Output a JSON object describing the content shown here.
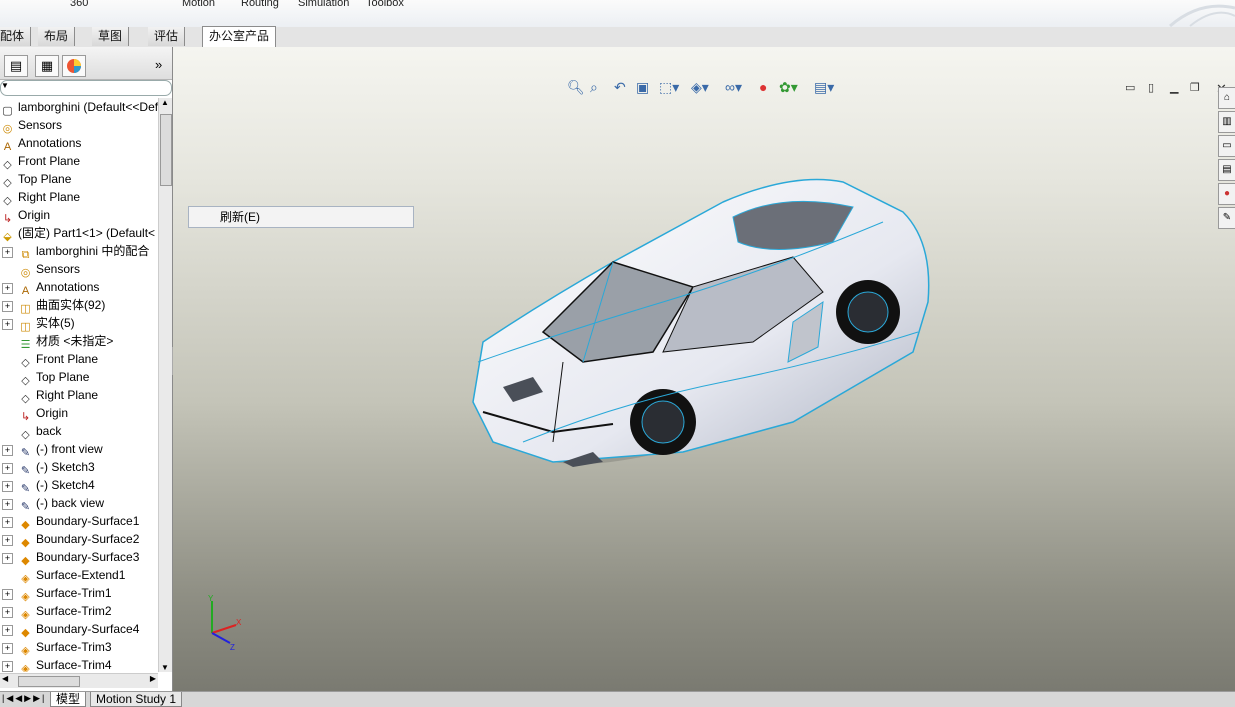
{
  "topbar": {
    "items": [
      "360",
      "Motion",
      "Routing",
      "Simulation",
      "Toolbox"
    ]
  },
  "tabs": [
    {
      "label": "配体",
      "active": false
    },
    {
      "label": "布局",
      "active": false
    },
    {
      "label": "草图",
      "active": false
    },
    {
      "label": "评估",
      "active": false
    },
    {
      "label": "办公室产品",
      "active": true
    }
  ],
  "panel": {
    "collapse_label": "»"
  },
  "tree": [
    {
      "label": "lamborghini  (Default<<Defau",
      "icon": "part-icon",
      "level": 0,
      "expander": false
    },
    {
      "label": "Sensors",
      "icon": "sensors-icon",
      "level": 0,
      "expander": false
    },
    {
      "label": "Annotations",
      "icon": "annotations-icon",
      "level": 0,
      "expander": false
    },
    {
      "label": "Front Plane",
      "icon": "plane-icon",
      "level": 0,
      "expander": false
    },
    {
      "label": "Top Plane",
      "icon": "plane-icon",
      "level": 0,
      "expander": false
    },
    {
      "label": "Right Plane",
      "icon": "plane-icon",
      "level": 0,
      "expander": false
    },
    {
      "label": "Origin",
      "icon": "origin-icon",
      "level": 0,
      "expander": false
    },
    {
      "label": "(固定) Part1<1> (Default<",
      "icon": "component-icon",
      "level": 0,
      "expander": false
    },
    {
      "label": "lamborghini 中的配合",
      "icon": "mates-icon",
      "level": 1,
      "expander": true
    },
    {
      "label": "Sensors",
      "icon": "sensors-icon",
      "level": 1,
      "expander": false
    },
    {
      "label": "Annotations",
      "icon": "annotations-icon",
      "level": 1,
      "expander": true
    },
    {
      "label": "曲面实体(92)",
      "icon": "surface-bodies-icon",
      "level": 1,
      "expander": true
    },
    {
      "label": "实体(5)",
      "icon": "solid-bodies-icon",
      "level": 1,
      "expander": true
    },
    {
      "label": "材质 <未指定>",
      "icon": "material-icon",
      "level": 1,
      "expander": false
    },
    {
      "label": "Front Plane",
      "icon": "plane-icon",
      "level": 1,
      "expander": false
    },
    {
      "label": "Top Plane",
      "icon": "plane-icon",
      "level": 1,
      "expander": false
    },
    {
      "label": "Right Plane",
      "icon": "plane-icon",
      "level": 1,
      "expander": false
    },
    {
      "label": "Origin",
      "icon": "origin-icon",
      "level": 1,
      "expander": false
    },
    {
      "label": "back",
      "icon": "plane-icon",
      "level": 1,
      "expander": false
    },
    {
      "label": "(-) front view",
      "icon": "sketch-icon",
      "level": 1,
      "expander": true
    },
    {
      "label": "(-) Sketch3",
      "icon": "sketch-icon",
      "level": 1,
      "expander": true
    },
    {
      "label": "(-) Sketch4",
      "icon": "sketch-icon",
      "level": 1,
      "expander": true
    },
    {
      "label": "(-) back view",
      "icon": "sketch-icon",
      "level": 1,
      "expander": true
    },
    {
      "label": "Boundary-Surface1",
      "icon": "boundary-surface-icon",
      "level": 1,
      "expander": true
    },
    {
      "label": "Boundary-Surface2",
      "icon": "boundary-surface-icon",
      "level": 1,
      "expander": true
    },
    {
      "label": "Boundary-Surface3",
      "icon": "boundary-surface-icon",
      "level": 1,
      "expander": true
    },
    {
      "label": "Surface-Extend1",
      "icon": "surface-extend-icon",
      "level": 1,
      "expander": false
    },
    {
      "label": "Surface-Trim1",
      "icon": "surface-trim-icon",
      "level": 1,
      "expander": true
    },
    {
      "label": "Surface-Trim2",
      "icon": "surface-trim-icon",
      "level": 1,
      "expander": true
    },
    {
      "label": "Boundary-Surface4",
      "icon": "boundary-surface-icon",
      "level": 1,
      "expander": true
    },
    {
      "label": "Surface-Trim3",
      "icon": "surface-trim-icon",
      "level": 1,
      "expander": true
    },
    {
      "label": "Surface-Trim4",
      "icon": "surface-trim-icon",
      "level": 1,
      "expander": true
    }
  ],
  "context_menu": {
    "item": "刷新(E)"
  },
  "bottom_tabs": [
    {
      "label": "模型",
      "active": true
    },
    {
      "label": "Motion Study 1",
      "active": false
    }
  ],
  "triad": {
    "x": "X",
    "y": "Y",
    "z": "Z"
  }
}
